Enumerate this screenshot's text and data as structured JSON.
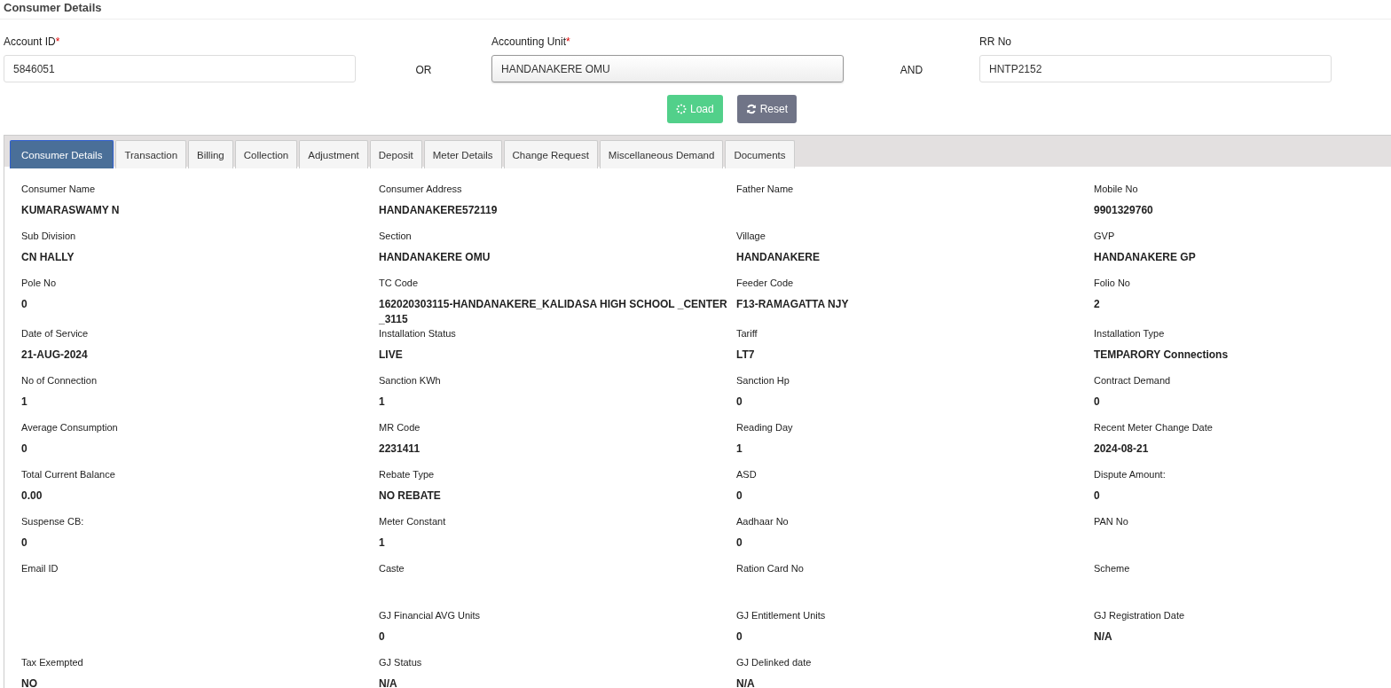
{
  "page_title": "Consumer Details",
  "form": {
    "account_id": {
      "label": "Account ID",
      "required_mark": "*",
      "value": "5846051"
    },
    "connector_1": "OR",
    "accounting_unit": {
      "label": "Accounting Unit",
      "required_mark": "*",
      "value": "HANDANAKERE OMU"
    },
    "connector_2": "AND",
    "rr_no": {
      "label": "RR No",
      "value": "HNTP2152"
    }
  },
  "buttons": [
    {
      "kind": "load",
      "label": "Load"
    },
    {
      "kind": "reset",
      "label": "Reset"
    }
  ],
  "tabs": [
    {
      "label": "Consumer Details",
      "selected": true
    },
    {
      "label": "Transaction",
      "selected": false
    },
    {
      "label": "Billing",
      "selected": false
    },
    {
      "label": "Collection",
      "selected": false
    },
    {
      "label": "Adjustment",
      "selected": false
    },
    {
      "label": "Deposit",
      "selected": false
    },
    {
      "label": "Meter Details",
      "selected": false
    },
    {
      "label": "Change Request",
      "selected": false
    },
    {
      "label": "Miscellaneous Demand",
      "selected": false
    },
    {
      "label": "Documents",
      "selected": false
    }
  ],
  "detail_rows": [
    [
      {
        "label": "Consumer Name",
        "value": "KUMARASWAMY N"
      },
      {
        "label": "Consumer Address",
        "value": "HANDANAKERE572119"
      },
      {
        "label": "Father Name"
      },
      {
        "label": "Mobile No",
        "value": "9901329760"
      }
    ],
    [
      {
        "label": "Sub Division",
        "value": "CN HALLY"
      },
      {
        "label": "Section",
        "value": "HANDANAKERE OMU"
      },
      {
        "label": "Village",
        "value": "HANDANAKERE"
      },
      {
        "label": "GVP",
        "value": "HANDANAKERE GP"
      }
    ],
    [
      {
        "label": "Pole No",
        "value": "0"
      },
      {
        "label": "TC Code",
        "value": "162020303115-HANDANAKERE_KALIDASA HIGH SCHOOL _CENTER_3115"
      },
      {
        "label": "Feeder Code",
        "value": "F13-RAMAGATTA NJY"
      },
      {
        "label": "Folio No",
        "value": "2"
      }
    ],
    [
      {
        "label": "Date of Service",
        "value": "21-AUG-2024"
      },
      {
        "label": "Installation Status",
        "value": "LIVE"
      },
      {
        "label": "Tariff",
        "value": "LT7"
      },
      {
        "label": "Installation Type",
        "value": "TEMPARORY Connections"
      }
    ],
    [
      {
        "label": "No of Connection",
        "value": "1"
      },
      {
        "label": "Sanction KWh",
        "value": "1"
      },
      {
        "label": "Sanction Hp",
        "value": "0"
      },
      {
        "label": "Contract Demand",
        "value": "0"
      }
    ],
    [
      {
        "label": "Average Consumption",
        "value": "0"
      },
      {
        "label": "MR Code",
        "value": "2231411"
      },
      {
        "label": "Reading Day",
        "value": "1"
      },
      {
        "label": "Recent Meter Change Date",
        "value": "2024-08-21"
      }
    ],
    [
      {
        "label": "Total Current Balance",
        "value": "0.00"
      },
      {
        "label": "Rebate Type",
        "value": "NO REBATE"
      },
      {
        "label": "ASD",
        "value": "0"
      },
      {
        "label": "Dispute Amount:",
        "value": "0"
      }
    ],
    [
      {
        "label": "Suspense CB:",
        "value": "0"
      },
      {
        "label": "Meter Constant",
        "value": "1"
      },
      {
        "label": "Aadhaar No",
        "value": "0"
      },
      {
        "label": "PAN No"
      }
    ],
    [
      {
        "label": "Email ID"
      },
      {
        "label": "Caste"
      },
      {
        "label": "Ration Card No"
      },
      {
        "label": "Scheme"
      }
    ],
    [
      null,
      {
        "label": "GJ Financial AVG Units",
        "value": "0"
      },
      {
        "label": "GJ Entitlement Units",
        "value": "0"
      },
      {
        "label": "GJ Registration Date",
        "value": "N/A"
      }
    ],
    [
      {
        "label": "Tax Exempted",
        "value": "NO"
      },
      {
        "label": "GJ Status",
        "value": "N/A"
      },
      {
        "label": "GJ Delinked date",
        "value": "N/A"
      },
      null
    ]
  ]
}
